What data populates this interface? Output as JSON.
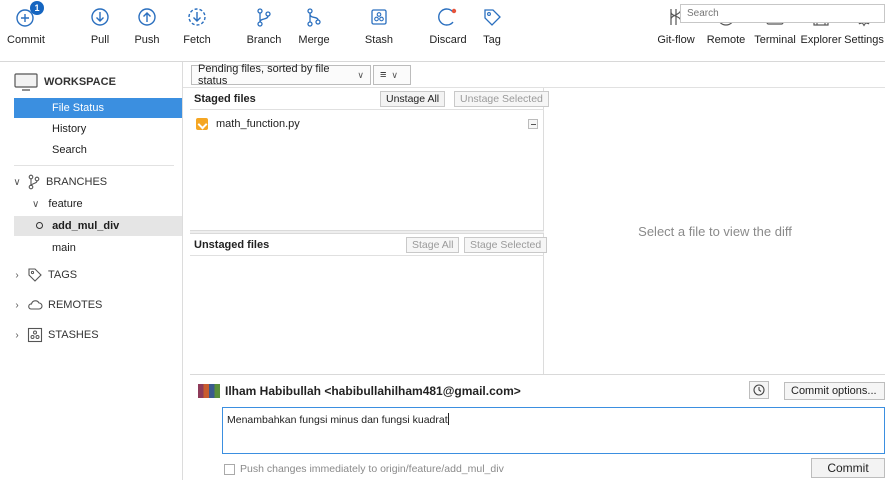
{
  "toolbar": {
    "commit": "Commit",
    "commit_badge": "1",
    "pull": "Pull",
    "push": "Push",
    "fetch": "Fetch",
    "branch": "Branch",
    "merge": "Merge",
    "stash": "Stash",
    "discard": "Discard",
    "tag": "Tag",
    "gitflow": "Git-flow",
    "remote": "Remote",
    "terminal": "Terminal",
    "explorer": "Explorer",
    "settings": "Settings"
  },
  "sidebar": {
    "workspace": "WORKSPACE",
    "file_status": "File Status",
    "history": "History",
    "search": "Search",
    "branches": "BRANCHES",
    "feature_folder": "feature",
    "current_branch": "add_mul_div",
    "main_branch": "main",
    "tags": "TAGS",
    "remotes": "REMOTES",
    "stashes": "STASHES"
  },
  "filter": {
    "sort_label": "Pending files, sorted by file status",
    "view_icon": "≡",
    "search_placeholder": "Search"
  },
  "staged": {
    "title": "Staged files",
    "unstage_all": "Unstage All",
    "unstage_selected": "Unstage Selected",
    "file": "math_function.py"
  },
  "unstaged": {
    "title": "Unstaged files",
    "stage_all": "Stage All",
    "stage_selected": "Stage Selected"
  },
  "diff": {
    "placeholder": "Select a file to view the diff"
  },
  "commit": {
    "author": "Ilham Habibullah <habibullahilham481@gmail.com>",
    "options": "Commit options...",
    "message": "Menambahkan fungsi minus dan fungsi kuadrat",
    "push_label": "Push changes immediately to origin/feature/add_mul_div",
    "button": "Commit"
  },
  "colors": {
    "selection": "#3b8fe0",
    "badge": "#1565c0",
    "modified_file": "#f5a623"
  }
}
